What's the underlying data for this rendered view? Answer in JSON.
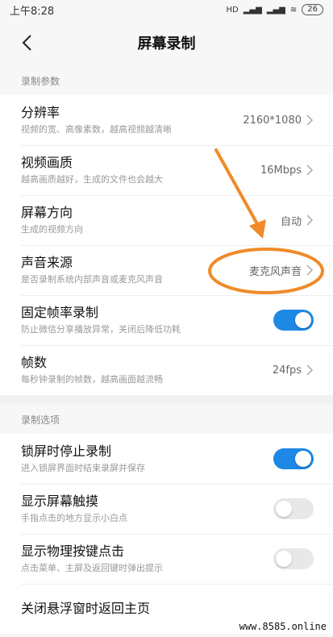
{
  "status_bar": {
    "time": "上午8:28",
    "battery": "26",
    "signal1": "HD",
    "signal2": "..l"
  },
  "nav": {
    "title": "屏幕录制"
  },
  "sections": [
    {
      "header": "录制参数",
      "rows": [
        {
          "title": "分辨率",
          "desc": "视频的宽、高像素数，越高视频越清晰",
          "value": "2160*1080",
          "type": "value"
        },
        {
          "title": "视频画质",
          "desc": "越高画质越好，生成的文件也会越大",
          "value": "16Mbps",
          "type": "value"
        },
        {
          "title": "屏幕方向",
          "desc": "生成的视频方向",
          "value": "自动",
          "type": "value"
        },
        {
          "title": "声音来源",
          "desc": "是否录制系统内部声音或麦克风声音",
          "value": "麦克风声音",
          "type": "value"
        },
        {
          "title": "固定帧率录制",
          "desc": "防止微信分享播放异常，关闭后降低功耗",
          "toggle": true,
          "type": "toggle"
        },
        {
          "title": "帧数",
          "desc": "每秒钟录制的帧数，越高画面越流畅",
          "value": "24fps",
          "type": "value"
        }
      ]
    },
    {
      "header": "录制选项",
      "rows": [
        {
          "title": "锁屏时停止录制",
          "desc": "进入锁屏界面时结束录屏并保存",
          "toggle": true,
          "type": "toggle"
        },
        {
          "title": "显示屏幕触摸",
          "desc": "手指点击的地方显示小白点",
          "toggle": false,
          "type": "toggle"
        },
        {
          "title": "显示物理按键点击",
          "desc": "点击菜单、主屏及返回键时弹出提示",
          "toggle": false,
          "type": "toggle"
        },
        {
          "title": "关闭悬浮窗时返回主页",
          "desc": "",
          "type": "value",
          "value": ""
        }
      ]
    }
  ],
  "colors": {
    "accent": "#1e88e5",
    "annotation": "#f08a2a"
  },
  "watermark": "www.8585.online"
}
